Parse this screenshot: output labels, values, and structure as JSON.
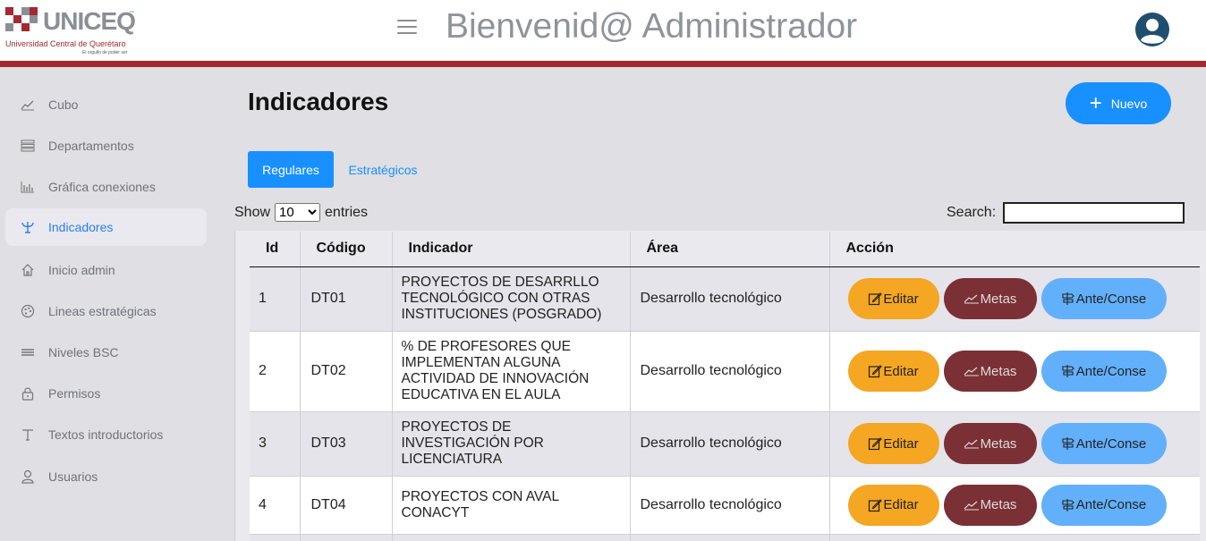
{
  "header": {
    "logo_text": "UNICEQ",
    "logo_subtitle": "Universidad Central de Querétaro",
    "logo_tagline": "El orgullo de poder ser",
    "welcome": "Bienvenid@ Administrador"
  },
  "sidebar": {
    "items": [
      {
        "label": "Cubo",
        "icon": "chart-line-icon"
      },
      {
        "label": "Departamentos",
        "icon": "list-icon"
      },
      {
        "label": "Gráfica conexiones",
        "icon": "bar-chart-icon"
      },
      {
        "label": "Indicadores",
        "icon": "trident-icon",
        "active": true
      },
      {
        "label": "Inicio admin",
        "icon": "home-icon"
      },
      {
        "label": "Lineas estratégicas",
        "icon": "palette-icon"
      },
      {
        "label": "Niveles BSC",
        "icon": "levels-icon"
      },
      {
        "label": "Permisos",
        "icon": "lock-icon"
      },
      {
        "label": "Textos introductorios",
        "icon": "text-icon"
      },
      {
        "label": "Usuarios",
        "icon": "user-icon"
      }
    ]
  },
  "main": {
    "title": "Indicadores",
    "new_button": "Nuevo",
    "tabs": [
      {
        "label": "Regulares",
        "active": true
      },
      {
        "label": "Estratégicos",
        "active": false
      }
    ],
    "show_label": "Show",
    "entries_value": "10",
    "entries_label": "entries",
    "search_label": "Search:",
    "search_value": ""
  },
  "table": {
    "headers": [
      "Id",
      "Código",
      "Indicador",
      "Área",
      "Acción"
    ],
    "rows": [
      {
        "id": "1",
        "codigo": "DT01",
        "indicador": "PROYECTOS DE DESARRLLO TECNOLÓGICO CON OTRAS INSTITUCIONES (POSGRADO)",
        "area": "Desarrollo tecnológico"
      },
      {
        "id": "2",
        "codigo": "DT02",
        "indicador": "% DE PROFESORES QUE IMPLEMENTAN ALGUNA ACTIVIDAD DE INNOVACIÓN EDUCATIVA EN EL AULA",
        "area": "Desarrollo tecnológico"
      },
      {
        "id": "3",
        "codigo": "DT03",
        "indicador": "PROYECTOS DE INVESTIGACIÓN POR LICENCIATURA",
        "area": "Desarrollo tecnológico"
      },
      {
        "id": "4",
        "codigo": "DT04",
        "indicador": "PROYECTOS CON AVAL CONACYT",
        "area": "Desarrollo tecnológico"
      }
    ],
    "actions": {
      "edit": "Editar",
      "metas": "Metas",
      "ante": "Ante/Conse"
    }
  },
  "colors": {
    "accent": "#1890ff",
    "header_bar": "#a32a32",
    "edit": "#f5a623",
    "metas": "#7b3035",
    "ante": "#62b0fb"
  }
}
